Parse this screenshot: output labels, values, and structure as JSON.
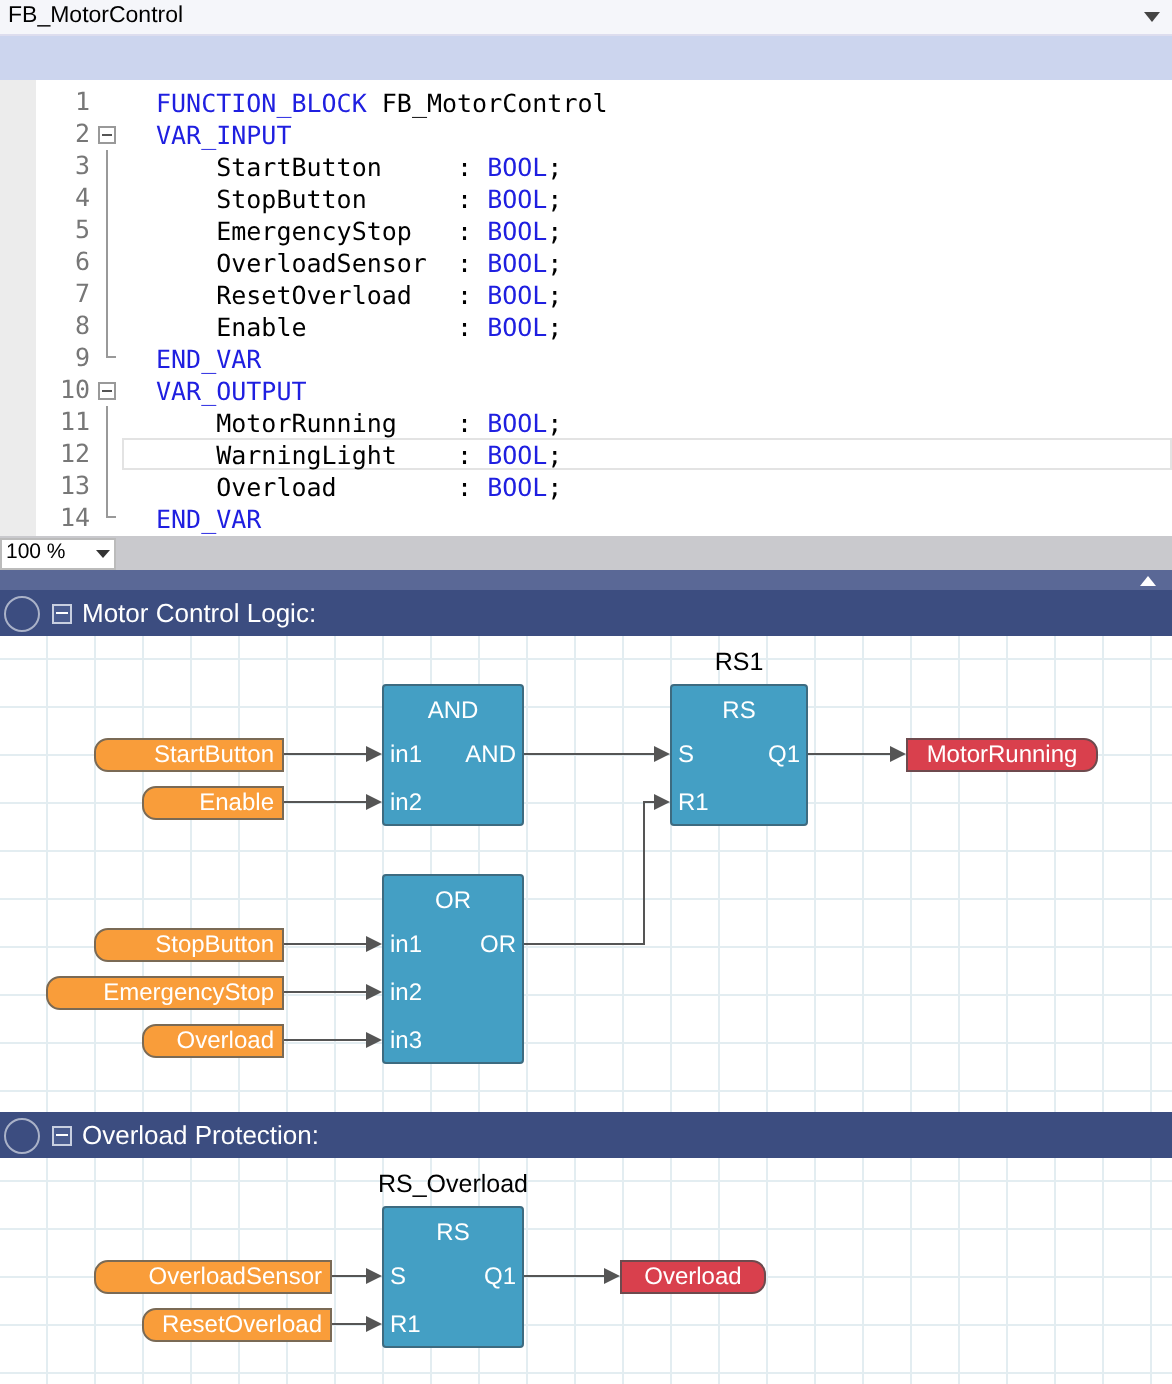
{
  "pou_selector": {
    "value": "FB_MotorControl"
  },
  "code_lines": [
    {
      "number": "1",
      "kind": "header",
      "keyword": "FUNCTION_BLOCK",
      "name": "FB_MotorControl",
      "fold_start": false,
      "in_fold": false,
      "fold_end": false,
      "current": false
    },
    {
      "number": "2",
      "kind": "section",
      "keyword": "VAR_INPUT",
      "fold_start": true,
      "expanded": true,
      "in_fold": false,
      "fold_end": false,
      "current": false
    },
    {
      "number": "3",
      "kind": "declaration",
      "name": "StartButton",
      "sep": ":",
      "type": "BOOL",
      "end": ";",
      "fold_start": false,
      "in_fold": true,
      "fold_end": false,
      "current": false
    },
    {
      "number": "4",
      "kind": "declaration",
      "name": "StopButton",
      "sep": ":",
      "type": "BOOL",
      "end": ";",
      "fold_start": false,
      "in_fold": true,
      "fold_end": false,
      "current": false
    },
    {
      "number": "5",
      "kind": "declaration",
      "name": "EmergencyStop",
      "sep": ":",
      "type": "BOOL",
      "end": ";",
      "fold_start": false,
      "in_fold": true,
      "fold_end": false,
      "current": false
    },
    {
      "number": "6",
      "kind": "declaration",
      "name": "OverloadSensor",
      "sep": ":",
      "type": "BOOL",
      "end": ";",
      "fold_start": false,
      "in_fold": true,
      "fold_end": false,
      "current": false
    },
    {
      "number": "7",
      "kind": "declaration",
      "name": "ResetOverload",
      "sep": ":",
      "type": "BOOL",
      "end": ";",
      "fold_start": false,
      "in_fold": true,
      "fold_end": false,
      "current": false
    },
    {
      "number": "8",
      "kind": "declaration",
      "name": "Enable",
      "sep": ":",
      "type": "BOOL",
      "end": ";",
      "fold_start": false,
      "in_fold": true,
      "fold_end": false,
      "current": false
    },
    {
      "number": "9",
      "kind": "section",
      "keyword": "END_VAR",
      "fold_start": false,
      "in_fold": false,
      "fold_end": true,
      "current": false
    },
    {
      "number": "10",
      "kind": "section",
      "keyword": "VAR_OUTPUT",
      "fold_start": true,
      "expanded": true,
      "in_fold": false,
      "fold_end": false,
      "current": false
    },
    {
      "number": "11",
      "kind": "declaration",
      "name": "MotorRunning",
      "sep": ":",
      "type": "BOOL",
      "end": ";",
      "fold_start": false,
      "in_fold": true,
      "fold_end": false,
      "current": false
    },
    {
      "number": "12",
      "kind": "declaration",
      "name": "WarningLight",
      "sep": ":",
      "type": "BOOL",
      "end": ";",
      "fold_start": false,
      "in_fold": true,
      "fold_end": false,
      "current": true
    },
    {
      "number": "13",
      "kind": "declaration",
      "name": "Overload",
      "sep": ":",
      "type": "BOOL",
      "end": ";",
      "fold_start": false,
      "in_fold": true,
      "fold_end": false,
      "current": false
    },
    {
      "number": "14",
      "kind": "section",
      "keyword": "END_VAR",
      "fold_start": false,
      "in_fold": false,
      "fold_end": true,
      "current": false
    }
  ],
  "zoom": {
    "value": "100 %"
  },
  "networks": [
    {
      "title": "Motor Control Logic:",
      "expanded": true,
      "blocks": [
        {
          "type": "AND",
          "inputs": [
            {
              "pin": "in1",
              "variable": "StartButton"
            },
            {
              "pin": "in2",
              "variable": "Enable"
            }
          ],
          "outputs": [
            {
              "pin": "AND"
            }
          ]
        },
        {
          "instance": "RS1",
          "type": "RS",
          "inputs": [
            {
              "pin": "S"
            },
            {
              "pin": "R1"
            }
          ],
          "outputs": [
            {
              "pin": "Q1",
              "variable": "MotorRunning"
            }
          ]
        },
        {
          "type": "OR",
          "inputs": [
            {
              "pin": "in1",
              "variable": "StopButton"
            },
            {
              "pin": "in2",
              "variable": "EmergencyStop"
            },
            {
              "pin": "in3",
              "variable": "Overload"
            }
          ],
          "outputs": [
            {
              "pin": "OR"
            }
          ]
        }
      ]
    },
    {
      "title": "Overload Protection:",
      "expanded": true,
      "blocks": [
        {
          "instance": "RS_Overload",
          "type": "RS",
          "inputs": [
            {
              "pin": "S",
              "variable": "OverloadSensor"
            },
            {
              "pin": "R1",
              "variable": "ResetOverload"
            }
          ],
          "outputs": [
            {
              "pin": "Q1",
              "variable": "Overload"
            }
          ]
        }
      ]
    }
  ]
}
